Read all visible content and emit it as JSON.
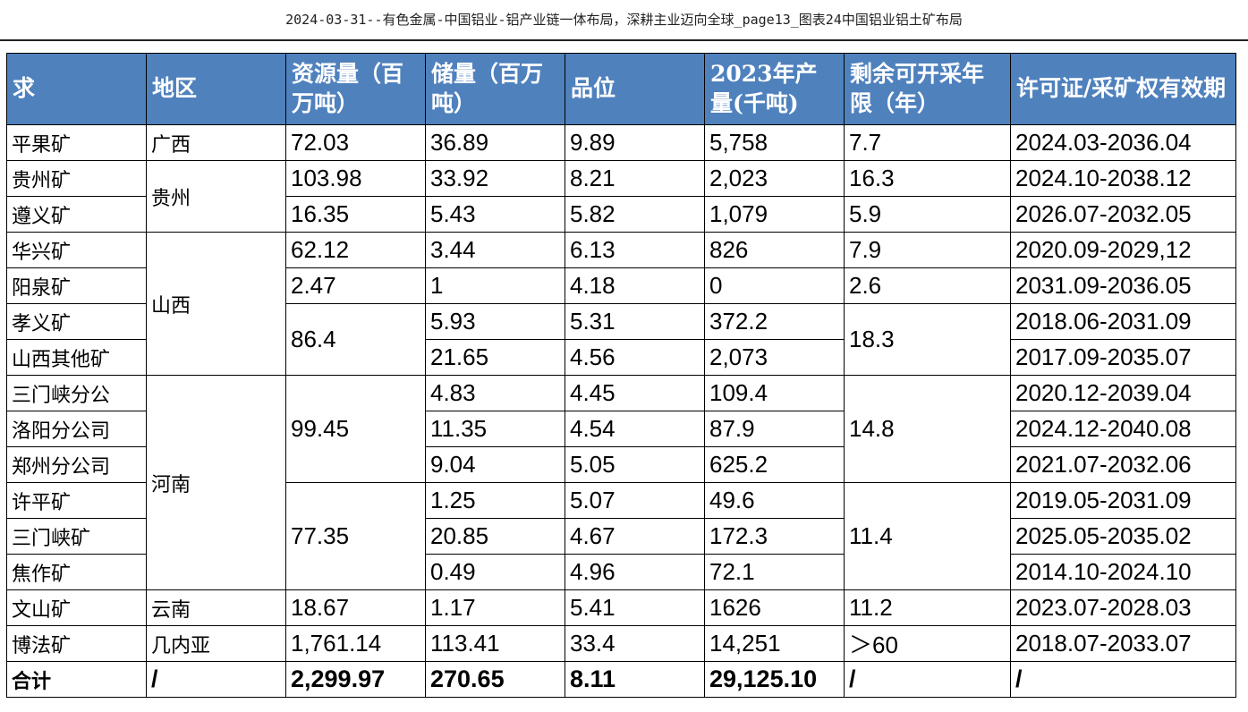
{
  "header": {
    "title": "2024-03-31--有色金属-中国铝业-铝产业链一体布局，深耕主业迈向全球_page13_图表24中国铝业铝土矿布局"
  },
  "table": {
    "headers": {
      "mine": "求",
      "region": "地区",
      "resources": "资源量（百万吨）",
      "reserves": "储量（百万吨）",
      "grade": "品位",
      "production": "2023年产量(千吨)",
      "life": "剩余可开采年限（年）",
      "license": "许可证/采矿权有效期"
    },
    "rows": [
      {
        "mine": "平果矿",
        "region": "广西",
        "resources": "72.03",
        "reserves": "36.89",
        "grade": "9.89",
        "production": "5,758",
        "life": "7.7",
        "license": "2024.03-2036.04"
      },
      {
        "mine": "贵州矿",
        "region": "贵州",
        "resources": "103.98",
        "reserves": "33.92",
        "grade": "8.21",
        "production": "2,023",
        "life": "16.3",
        "license": "2024.10-2038.12"
      },
      {
        "mine": "遵义矿",
        "resources": "16.35",
        "reserves": "5.43",
        "grade": "5.82",
        "production": "1,079",
        "life": "5.9",
        "license": "2026.07-2032.05"
      },
      {
        "mine": "华兴矿",
        "region": "山西",
        "resources": "62.12",
        "reserves": "3.44",
        "grade": "6.13",
        "production": "826",
        "life": "7.9",
        "license": "2020.09-2029,12"
      },
      {
        "mine": "阳泉矿",
        "resources": "2.47",
        "reserves": "1",
        "grade": "4.18",
        "production": "0",
        "life": "2.6",
        "license": "2031.09-2036.05"
      },
      {
        "mine": "孝义矿",
        "resources": "86.4",
        "reserves": "5.93",
        "grade": "5.31",
        "production": "372.2",
        "life": "18.3",
        "license": "2018.06-2031.09"
      },
      {
        "mine": "山西其他矿",
        "reserves": "21.65",
        "grade": "4.56",
        "production": "2,073",
        "license": "2017.09-2035.07"
      },
      {
        "mine": "三门峡分公",
        "region": "河南",
        "resources": "99.45",
        "reserves": "4.83",
        "grade": "4.45",
        "production": "109.4",
        "life": "14.8",
        "license": "2020.12-2039.04"
      },
      {
        "mine": "洛阳分公司",
        "reserves": "11.35",
        "grade": "4.54",
        "production": "87.9",
        "license": "2024.12-2040.08"
      },
      {
        "mine": "郑州分公司",
        "reserves": "9.04",
        "grade": "5.05",
        "production": "625.2",
        "license": "2021.07-2032.06"
      },
      {
        "mine": "许平矿",
        "resources": "77.35",
        "reserves": "1.25",
        "grade": "5.07",
        "production": "49.6",
        "life": "11.4",
        "license": "2019.05-2031.09"
      },
      {
        "mine": "三门峡矿",
        "reserves": "20.85",
        "grade": "4.67",
        "production": "172.3",
        "license": "2025.05-2035.02"
      },
      {
        "mine": "焦作矿",
        "reserves": "0.49",
        "grade": "4.96",
        "production": "72.1",
        "license": "2014.10-2024.10"
      },
      {
        "mine": "文山矿",
        "region": "云南",
        "resources": "18.67",
        "reserves": "1.17",
        "grade": "5.41",
        "production": "1626",
        "life": "11.2",
        "license": "2023.07-2028.03"
      },
      {
        "mine": "博法矿",
        "region": "几内亚",
        "resources": "1,761.14",
        "reserves": "113.41",
        "grade": "33.4",
        "production": "14,251",
        "life": "＞60",
        "license": "2018.07-2033.07"
      }
    ],
    "total": {
      "mine": "合计",
      "region": "/",
      "resources": "2,299.97",
      "reserves": "270.65",
      "grade": "8.11",
      "production": "29,125.10",
      "life": "/",
      "license": "/"
    }
  }
}
